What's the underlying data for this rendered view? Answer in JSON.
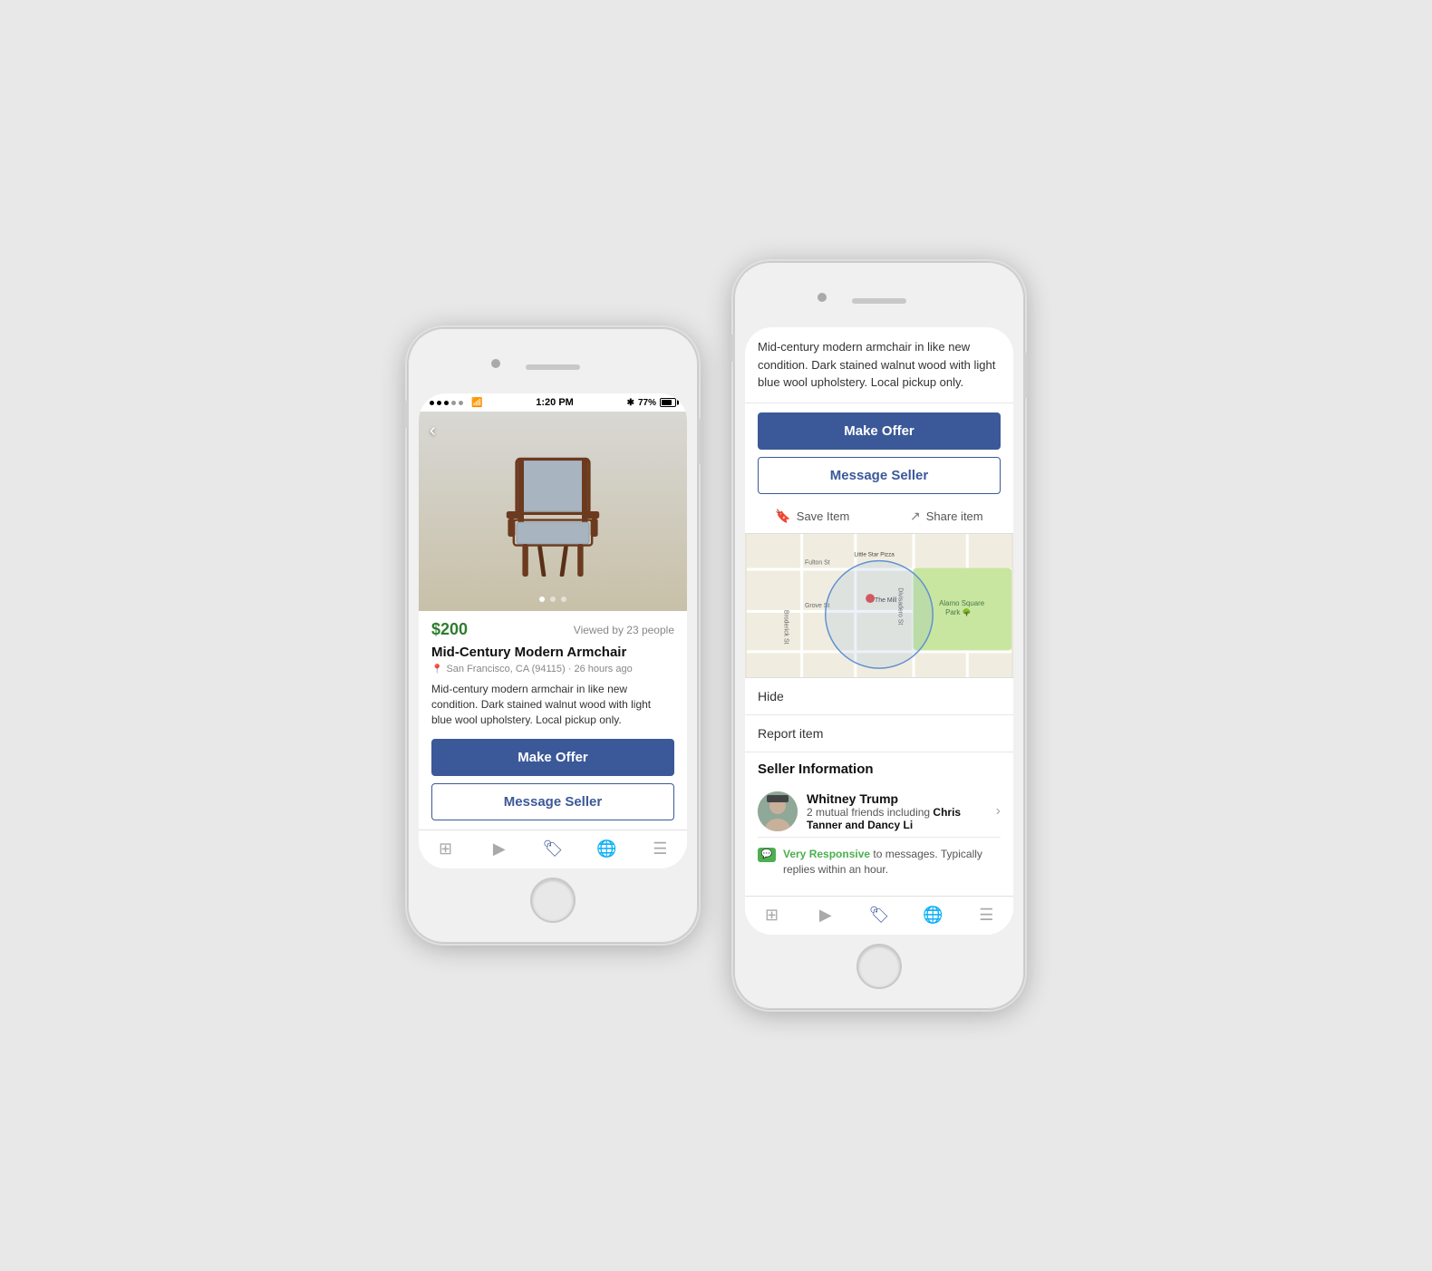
{
  "phone1": {
    "statusBar": {
      "time": "1:20 PM",
      "battery": "77%",
      "signal": "●●●○○"
    },
    "price": "$200",
    "viewedBy": "Viewed by 23 people",
    "productTitle": "Mid-Century Modern Armchair",
    "productMeta": "San Francisco, CA (94115) · 26 hours ago",
    "productDesc": "Mid-century modern armchair in like new condition. Dark stained walnut wood with light blue wool upholstery. Local pickup only.",
    "makeOfferLabel": "Make Offer",
    "messageSellerLabel": "Message Seller",
    "backArrow": "‹"
  },
  "phone2": {
    "descText": "Mid-century modern armchair in like new condition. Dark stained walnut wood with light blue wool upholstery. Local pickup only.",
    "makeOfferLabel": "Make Offer",
    "messageSellerLabel": "Message Seller",
    "saveItemLabel": "Save Item",
    "shareItemLabel": "Share item",
    "hideLabel": "Hide",
    "reportLabel": "Report item",
    "sellerSection": {
      "title": "Seller Information",
      "name": "Whitney Trump",
      "mutualFriends": "2 mutual friends including",
      "friend1": "Chris Tanner",
      "friend2": "and Dancy Li",
      "responsiveLabel": "Very Responsive",
      "responsiveText": " to messages. Typically replies within an hour."
    },
    "mapLabels": {
      "fultonSt": "Fulton St",
      "groveSt": "Grove St",
      "divisadero": "Divisadero St",
      "broderick": "Broderick St",
      "theMill": "The Mill",
      "alamoSquare": "Alamo Square Park",
      "littleStarPizza": "Little Star Pizza"
    }
  },
  "nav": {
    "items": [
      "⬜",
      "▶",
      "🏷",
      "🌐",
      "☰"
    ]
  }
}
